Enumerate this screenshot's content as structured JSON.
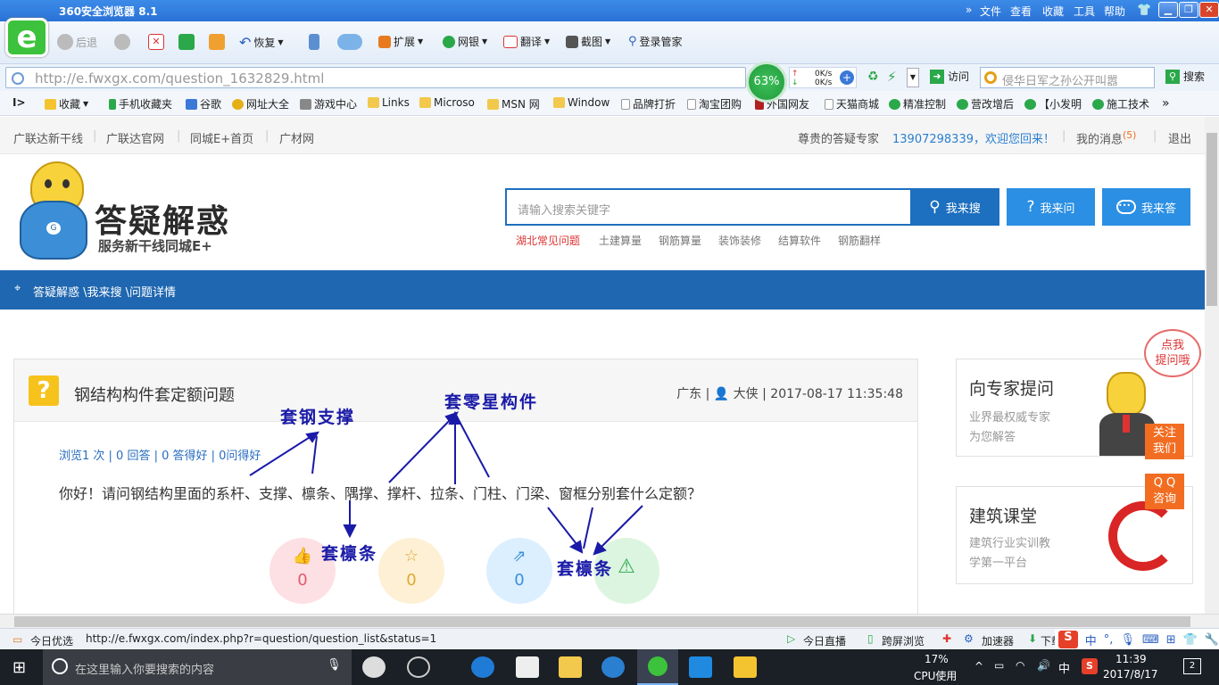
{
  "browser": {
    "title": "360安全浏览器 8.1",
    "menu": [
      "文件",
      "查看",
      "收藏",
      "工具",
      "帮助"
    ],
    "toolbar": {
      "back": "后退",
      "restore": "恢复",
      "extensions": "扩展",
      "bank": "网银",
      "translate": "翻译",
      "screenshot": "截图",
      "login_manager": "登录管家"
    },
    "address": "http://e.fwxgx.com/question_1632829.html",
    "speed_percent": "63%",
    "speed_up": "0K/s",
    "speed_down": "0K/s",
    "visit": "访问",
    "search_placeholder": "侵华日军之孙公开叫嚣",
    "search_btn": "搜索",
    "bookmarks": [
      "收藏",
      "手机收藏夹",
      "谷歌",
      "网址大全",
      "游戏中心",
      "Links",
      "Microso",
      "MSN 网",
      "Window",
      "品牌打折",
      "淘宝团购",
      "外国网友",
      "天猫商城",
      "精准控制",
      "营改增后",
      "【小发明",
      "施工技术"
    ]
  },
  "page": {
    "topnav_left": [
      "广联达新干线",
      "广联达官网",
      "同城E+首页",
      "广材网"
    ],
    "greeting": "尊贵的答疑专家",
    "user": "13907298339，欢迎您回来！",
    "messages_label": "我的消息",
    "messages_count": "(5)",
    "logout": "退出",
    "logo_title": "答疑解惑",
    "logo_sub": "服务新干线同城E+",
    "search_placeholder": "请输入搜索关键字",
    "btn_search": "我来搜",
    "btn_ask": "我来问",
    "btn_answer": "我来答",
    "hot": [
      "湖北常见问题",
      "土建算量",
      "钢筋算量",
      "装饰装修",
      "结算软件",
      "钢筋翻样"
    ],
    "breadcrumb": "答疑解惑 \\我来搜 \\问题详情",
    "question": {
      "title": "钢结构构件套定额问题",
      "meta": "广东 | 👤 大侠 | 2017-08-17 11:35:48",
      "stats": "浏览1 次 | 0 回答 | 0 答得好 | 0问得好",
      "text": "你好！请问钢结构里面的系杆、支撑、檩条、隅撑、撑杆、拉条、门柱、门梁、窗框分别套什么定额？",
      "counts": [
        "0",
        "0",
        "0"
      ]
    },
    "annotations": {
      "steel_support": "套钢支撑",
      "misc_member": "套零星构件",
      "purlin_1": "套檩条",
      "purlin_2": "套檩条"
    },
    "side1": {
      "title": "向专家提问",
      "line1": "业界最权威专家",
      "line2": "为您解答",
      "bubble": "点我\n提问哦"
    },
    "side2": {
      "title": "建筑课堂",
      "line1": "建筑行业实训教",
      "line2": "学第一平台"
    },
    "follow": "关注\n我们",
    "qq": "Q Q\n咨询"
  },
  "statusbar": {
    "left": "今日优选",
    "url": "http://e.fwxgx.com/index.php?r=question/question_list&status=1",
    "live": "今日直播",
    "cross": "跨屏浏览",
    "accelerator": "加速器",
    "download": "下载"
  },
  "taskbar": {
    "search_placeholder": "在这里输入你要搜索的内容",
    "cpu": "17%",
    "cpu_label": "CPU使用",
    "ime": "中",
    "time": "11:39",
    "date": "2017/8/17",
    "notifications": "2"
  }
}
